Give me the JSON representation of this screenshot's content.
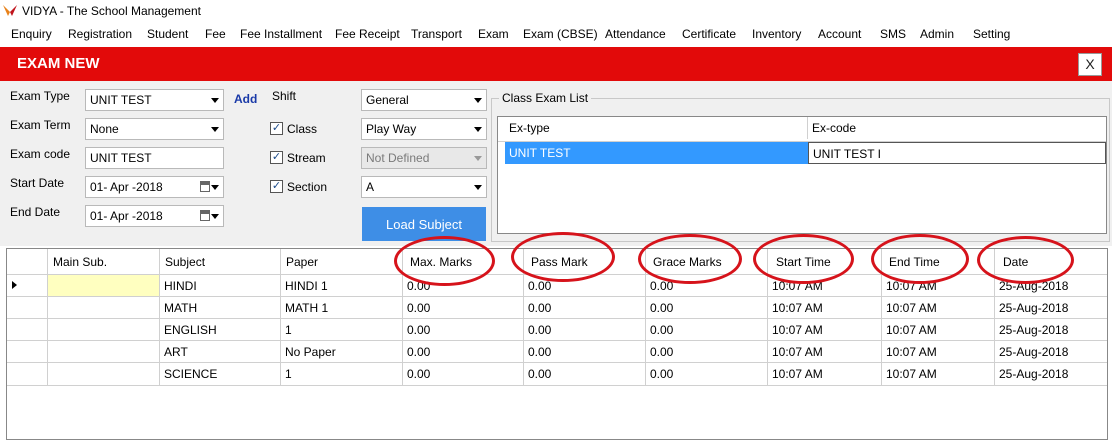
{
  "window": {
    "title": "VIDYA - The School Management"
  },
  "menu": [
    "Enquiry",
    "Registration",
    "Student",
    "Fee",
    "Fee Installment",
    "Fee Receipt",
    "Transport",
    "Exam",
    "Exam (CBSE)",
    "Attendance",
    "Certificate",
    "Inventory",
    "Account",
    "SMS",
    "Admin",
    "Setting"
  ],
  "header": {
    "title": "EXAM NEW",
    "close_label": "X"
  },
  "form": {
    "exam_type": {
      "label": "Exam Type",
      "value": "UNIT TEST",
      "add_label": "Add"
    },
    "exam_term": {
      "label": "Exam Term",
      "value": "None"
    },
    "exam_code": {
      "label": "Exam code",
      "value": "UNIT TEST"
    },
    "start_date": {
      "label": "Start Date",
      "value": "01- Apr -2018"
    },
    "end_date": {
      "label": "End Date",
      "value": "01- Apr -2018"
    },
    "shift": {
      "label": "Shift",
      "value": "General"
    },
    "class": {
      "label": "Class",
      "value": "Play Way",
      "checked": true
    },
    "stream": {
      "label": "Stream",
      "value": "Not Defined",
      "checked": true
    },
    "section": {
      "label": "Section",
      "value": "A",
      "checked": true
    },
    "load_button": "Load Subject"
  },
  "class_exam_list": {
    "title": "Class Exam List",
    "columns": [
      "Ex-type",
      "Ex-code"
    ],
    "rows": [
      [
        "UNIT TEST",
        "UNIT TEST I"
      ]
    ],
    "selected_color": "#3399ff"
  },
  "grid": {
    "columns": [
      "Main Sub.",
      "Subject",
      "Paper",
      "Max. Marks",
      "Pass Mark",
      "Grace Marks",
      "Start Time",
      "End Time",
      "Date"
    ],
    "rows": [
      [
        "",
        "HINDI",
        "HINDI 1",
        "0.00",
        "0.00",
        "0.00",
        "10:07 AM",
        "10:07 AM",
        "25-Aug-2018"
      ],
      [
        "",
        "MATH",
        "MATH 1",
        "0.00",
        "0.00",
        "0.00",
        "10:07 AM",
        "10:07 AM",
        "25-Aug-2018"
      ],
      [
        "",
        "ENGLISH",
        "1",
        "0.00",
        "0.00",
        "0.00",
        "10:07 AM",
        "10:07 AM",
        "25-Aug-2018"
      ],
      [
        "",
        "ART",
        "No Paper",
        "0.00",
        "0.00",
        "0.00",
        "10:07 AM",
        "10:07 AM",
        "25-Aug-2018"
      ],
      [
        "",
        "SCIENCE",
        "1",
        "0.00",
        "0.00",
        "0.00",
        "10:07 AM",
        "10:07 AM",
        "25-Aug-2018"
      ]
    ],
    "highlight_color": "#ffffc0"
  },
  "colors": {
    "header_red": "#e20a0a",
    "annotation_red": "#d6131b",
    "button_blue": "#3e8ee6"
  }
}
